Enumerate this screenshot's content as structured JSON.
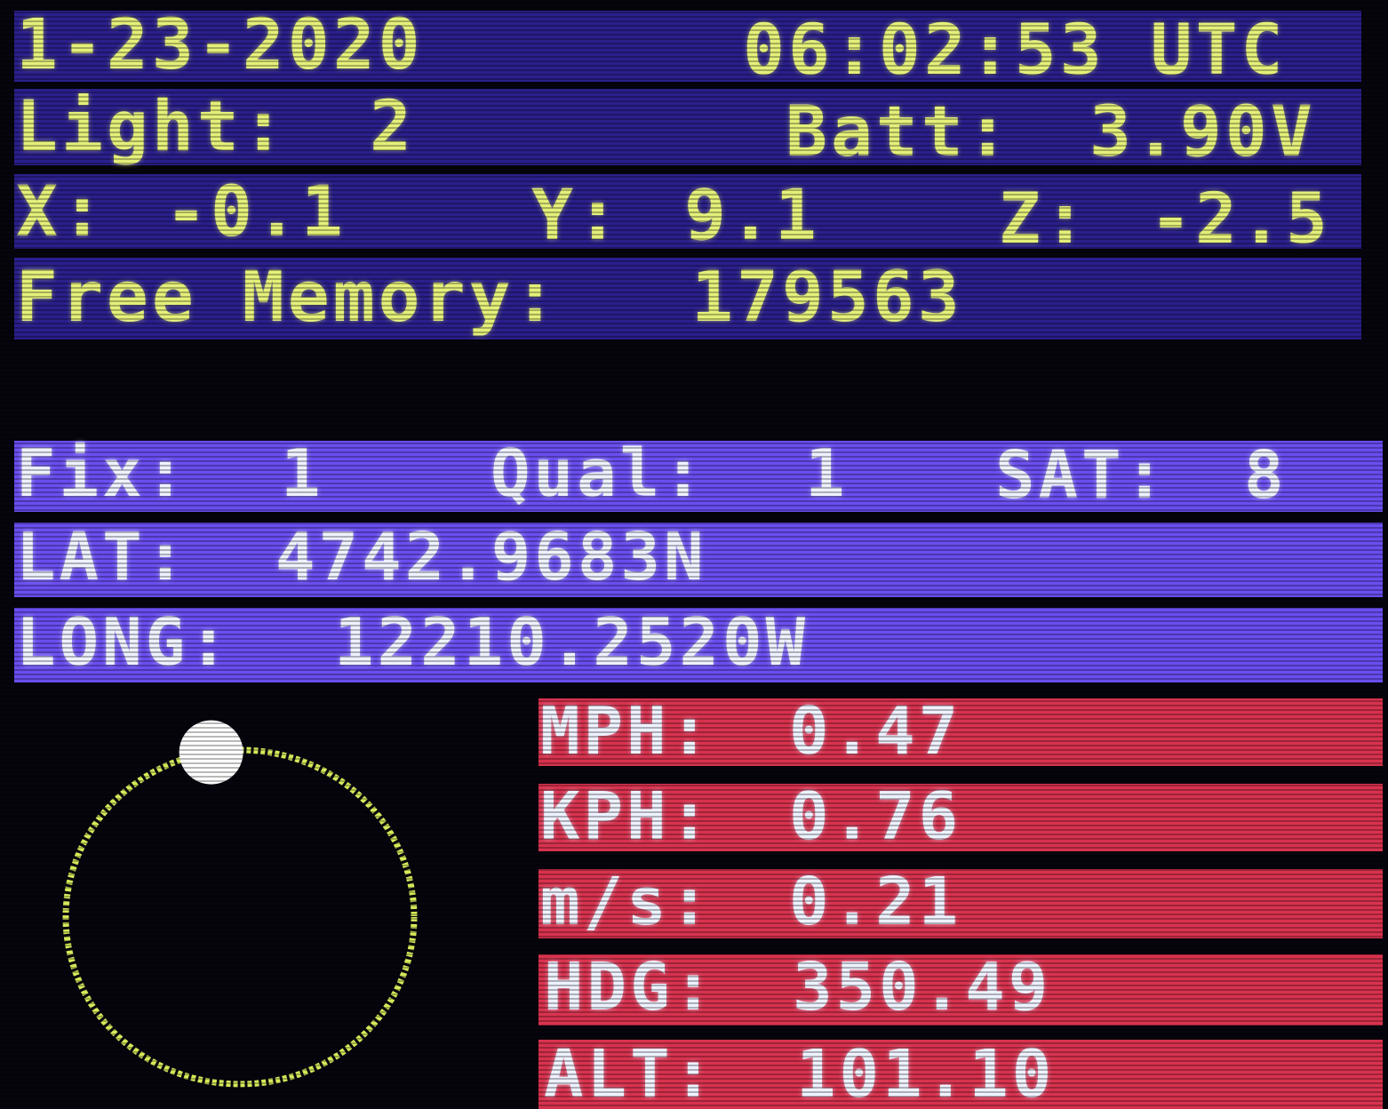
{
  "status": {
    "date": "1-23-2020",
    "time": "06:02:53 UTC",
    "light_label": "Light:",
    "light_value": "2",
    "batt_label": "Batt:",
    "batt_value": "3.90V",
    "x_label": "X:",
    "x_value": "-0.1",
    "y_label": "Y:",
    "y_value": "9.1",
    "z_label": "Z:",
    "z_value": "-2.5",
    "memory_label": "Free Memory:",
    "memory_value": "179563"
  },
  "gps": {
    "fix_label": "Fix:",
    "fix_value": "1",
    "qual_label": "Qual:",
    "qual_value": "1",
    "sat_label": "SAT:",
    "sat_value": "8",
    "lat_label": "LAT:",
    "lat_value": "4742.9683N",
    "long_label": "LONG:",
    "long_value": "12210.2520W"
  },
  "speed": {
    "mph_label": "MPH:",
    "mph_value": "0.47",
    "kph_label": "KPH:",
    "kph_value": "0.76",
    "ms_label": "m/s:",
    "ms_value": "0.21",
    "hdg_label": "HDG:",
    "hdg_value": "350.49",
    "alt_label": "ALT:",
    "alt_value": "101.10"
  },
  "compass": {
    "heading_deg": 350.49,
    "ring_color": "#d6e85a",
    "dot_color": "#ffffff"
  },
  "colors": {
    "status_band": "#2a1f8c",
    "gps_band": "#6a4ef0",
    "speed_band": "#d8324e",
    "status_text": "#e4f07a",
    "gps_text": "#eef2ff"
  }
}
